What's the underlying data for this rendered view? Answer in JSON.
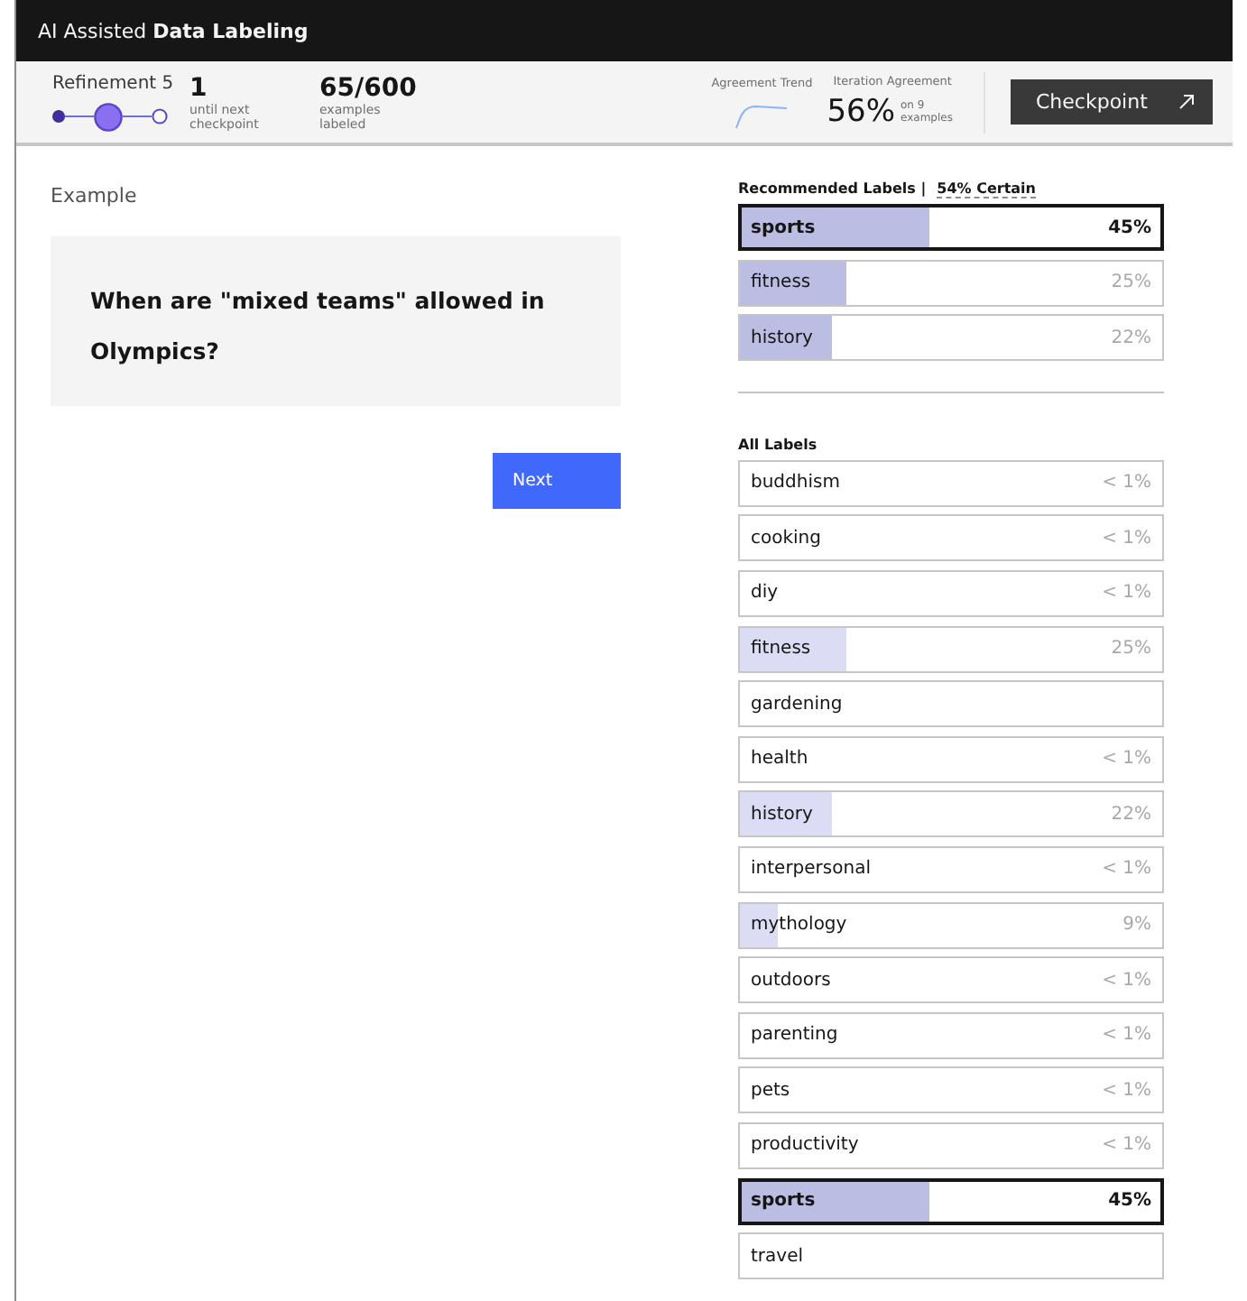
{
  "app_bar": {
    "title_plain": "AI Assisted",
    "title_bold": "Data Labeling"
  },
  "status": {
    "refinement": "Refinement 5",
    "steps": [
      {
        "kind": "done"
      },
      {
        "kind": "current"
      },
      {
        "kind": "todo"
      }
    ],
    "until_value": "1",
    "until_caption": "until next checkpoint",
    "examples_value": "65/600",
    "examples_caption": "examples labeled",
    "trend_label": "Agreement Trend",
    "agreement_label": "Iteration Agreement",
    "agreement_value": "56%",
    "agreement_caption": "on 9 examples",
    "checkpoint_button": "Checkpoint"
  },
  "example": {
    "heading": "Example",
    "text": "When are \"mixed teams\" allowed in Olympics?",
    "next_button": "Next"
  },
  "recommended": {
    "heading": "Recommended Labels |",
    "certainty": "54% Certain",
    "labels": [
      {
        "name": "sports",
        "percent": "45%",
        "level": 0.45,
        "selected": true
      },
      {
        "name": "fitness",
        "percent": "25%",
        "level": 0.25,
        "selected": false
      },
      {
        "name": "history",
        "percent": "22%",
        "level": 0.22,
        "selected": false
      }
    ]
  },
  "all_labels": {
    "heading": "All Labels",
    "labels": [
      {
        "name": "buddhism",
        "percent": "< 1%",
        "selected": false
      },
      {
        "name": "cooking",
        "percent": "< 1%",
        "selected": false
      },
      {
        "name": "diy",
        "percent": "< 1%",
        "selected": false
      },
      {
        "name": "fitness",
        "percent": "25%",
        "level": 0.25,
        "selected": false
      },
      {
        "name": "gardening",
        "selected": false
      },
      {
        "name": "health",
        "percent": "< 1%",
        "selected": false
      },
      {
        "name": "history",
        "percent": "22%",
        "level": 0.22,
        "selected": false
      },
      {
        "name": "interpersonal",
        "percent": "< 1%",
        "selected": false
      },
      {
        "name": "mythology",
        "percent": "9%",
        "level": 0.09,
        "selected": false
      },
      {
        "name": "outdoors",
        "percent": "< 1%",
        "selected": false
      },
      {
        "name": "parenting",
        "percent": "< 1%",
        "selected": false
      },
      {
        "name": "pets",
        "percent": "< 1%",
        "selected": false
      },
      {
        "name": "productivity",
        "percent": "< 1%",
        "selected": false
      },
      {
        "name": "sports",
        "percent": "45%",
        "level": 0.45,
        "selected": true
      },
      {
        "name": "travel",
        "selected": false
      }
    ]
  }
}
